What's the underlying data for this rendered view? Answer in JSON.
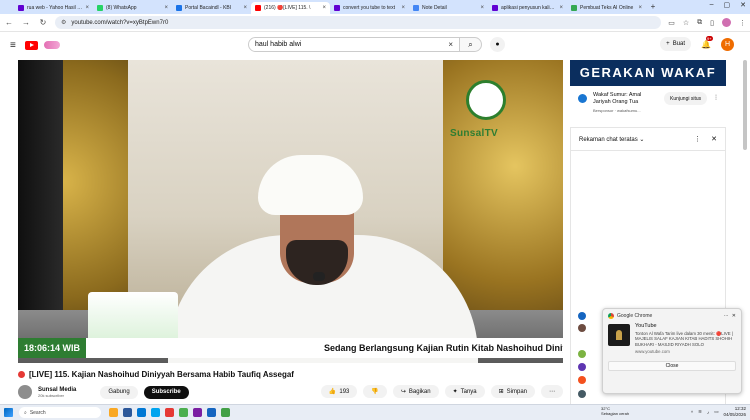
{
  "tabs": [
    {
      "title": "rua web - Yahoo Hasil Pe",
      "color": "#6001d2"
    },
    {
      "title": "(8) WhatsApp",
      "color": "#25d366"
    },
    {
      "title": "Portal Bacaindl - KBI",
      "color": "#1a73e8"
    },
    {
      "title": "(216) 🔴[LIVE] 115. \\",
      "color": "#ff0000"
    },
    {
      "title": "convert you tube to text",
      "color": "#6001d2"
    },
    {
      "title": "Note Detail",
      "color": "#4285f4"
    },
    {
      "title": "aplikasi penyusun kalimat",
      "color": "#6001d2"
    },
    {
      "title": "Pembuat Teks AI Online",
      "color": "#34a853"
    }
  ],
  "browser": {
    "url": "youtube.com/watch?v=xyBtpEwn7r0",
    "back_icon": "back-arrow-icon",
    "forward_icon": "forward-arrow-icon",
    "reload_icon": "reload-icon"
  },
  "youtube": {
    "search_query": "haul habib alwi",
    "create_label": "Buat",
    "notification_count": "9+",
    "avatar_letter": "H"
  },
  "video": {
    "time_overlay": "18:06:14 WIB",
    "ticker": "Sedang Berlangsung Kajian Rutin Kitab Nashoihud Diniyah",
    "brand": "SunsalTV",
    "title": "[LIVE] 115. Kajian Nashoihud Diniyyah Bersama Habib Taufiq Assegaf",
    "channel_name": "Sunsal Media",
    "channel_subs": "20k subscriber",
    "join_label": "Gabung",
    "subscribe_label": "Subscribe",
    "like_count": "193",
    "share_label": "Bagikan",
    "ask_label": "Tanya",
    "save_label": "Simpan"
  },
  "sidebar": {
    "ad_banner": "GERAKAN WAKAF SUMUR",
    "ad_title": "Wakaf Sumur: Amal Jariyah Orang Tua",
    "ad_sponsor": "Bersponsor · wakafsumu...",
    "ad_button": "Kunjungi situs",
    "chat_label": "Rekaman chat teratas"
  },
  "toast": {
    "app": "Google Chrome",
    "title": "YouTube",
    "message": "Tonton Al Wafa Tarim live dalam 30 menit: 🔴LIVE | MAJELIS SALAF KAJIAN KITAB HADITS SHOHIH BUKHARI - MASJID RIYADH SOLO",
    "url": "www.youtube.com",
    "close_label": "Close"
  },
  "taskbar": {
    "search_placeholder": "Search",
    "weather_temp": "32°C",
    "weather_desc": "Sebagian cerah",
    "time": "12:32",
    "date": "04/05/2026"
  }
}
